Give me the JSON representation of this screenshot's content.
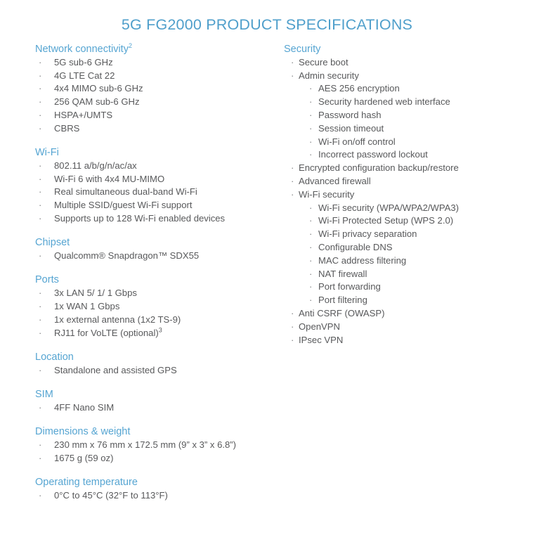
{
  "document": {
    "title": "5G FG2000 PRODUCT SPECIFICATIONS",
    "colors": {
      "title": "#4f9fcb",
      "heading": "#56a5d2",
      "body": "#58595b",
      "bullet": "#7b7c7e",
      "background": "#ffffff"
    },
    "bullet_glyph": "·"
  },
  "left_column": {
    "sections": [
      {
        "heading": "Network connectivity",
        "heading_superscript": "2",
        "items": [
          {
            "text": "5G sub-6 GHz"
          },
          {
            "text": "4G LTE Cat 22"
          },
          {
            "text": "4x4 MIMO sub-6 GHz"
          },
          {
            "text": "256 QAM sub-6 GHz"
          },
          {
            "text": "HSPA+/UMTS"
          },
          {
            "text": "CBRS"
          }
        ]
      },
      {
        "heading": "Wi-Fi",
        "heading_superscript": "",
        "items": [
          {
            "text": "802.11 a/b/g/n/ac/ax"
          },
          {
            "text": "Wi-Fi 6 with 4x4 MU-MIMO"
          },
          {
            "text": "Real simultaneous dual-band Wi-Fi"
          },
          {
            "text": "Multiple SSID/guest Wi-Fi support"
          },
          {
            "text": "Supports up to 128 Wi-Fi enabled devices"
          }
        ]
      },
      {
        "heading": "Chipset",
        "heading_superscript": "",
        "items": [
          {
            "text": "Qualcomm® Snapdragon™ SDX55"
          }
        ]
      },
      {
        "heading": "Ports",
        "heading_superscript": "",
        "items": [
          {
            "text": "3x LAN 5/ 1/ 1 Gbps"
          },
          {
            "text": "1x WAN 1 Gbps"
          },
          {
            "text": "1x external antenna (1x2 TS-9)"
          },
          {
            "text": "RJ11 for VoLTE (optional)",
            "superscript": "3"
          }
        ]
      },
      {
        "heading": "Location",
        "heading_superscript": "",
        "items": [
          {
            "text": "Standalone and assisted GPS"
          }
        ]
      },
      {
        "heading": "SIM",
        "heading_superscript": "",
        "items": [
          {
            "text": "4FF Nano SIM"
          }
        ]
      },
      {
        "heading": "Dimensions & weight",
        "heading_superscript": "",
        "items": [
          {
            "text": "230 mm x 76 mm x 172.5 mm (9” x 3” x 6.8”)"
          },
          {
            "text": "1675 g (59 oz)"
          }
        ]
      },
      {
        "heading": "Operating temperature",
        "heading_superscript": "",
        "items": [
          {
            "text": "0°C to 45°C (32°F to 113°F)"
          }
        ]
      }
    ]
  },
  "right_column": {
    "sections": [
      {
        "heading": "Security",
        "heading_superscript": "",
        "items": [
          {
            "level": 1,
            "text": "Secure boot"
          },
          {
            "level": 1,
            "text": "Admin security"
          },
          {
            "level": 2,
            "text": "AES 256 encryption"
          },
          {
            "level": 2,
            "text": "Security hardened web interface"
          },
          {
            "level": 2,
            "text": "Password hash"
          },
          {
            "level": 2,
            "text": "Session timeout"
          },
          {
            "level": 2,
            "text": "Wi-Fi on/off control"
          },
          {
            "level": 2,
            "text": "Incorrect password lockout"
          },
          {
            "level": 1,
            "text": "Encrypted configuration backup/restore"
          },
          {
            "level": 1,
            "text": "Advanced firewall"
          },
          {
            "level": 1,
            "text": "Wi-Fi security"
          },
          {
            "level": 2,
            "text": "Wi-Fi security (WPA/WPA2/WPA3)"
          },
          {
            "level": 2,
            "text": "Wi-Fi Protected Setup (WPS 2.0)"
          },
          {
            "level": 2,
            "text": "Wi-Fi privacy separation"
          },
          {
            "level": 2,
            "text": "Configurable DNS"
          },
          {
            "level": 2,
            "text": "MAC address filtering"
          },
          {
            "level": 2,
            "text": "NAT firewall"
          },
          {
            "level": 2,
            "text": "Port forwarding"
          },
          {
            "level": 2,
            "text": "Port filtering"
          },
          {
            "level": 1,
            "text": "Anti CSRF (OWASP)"
          },
          {
            "level": 1,
            "text": "OpenVPN"
          },
          {
            "level": 1,
            "text": "IPsec VPN"
          }
        ]
      }
    ]
  }
}
